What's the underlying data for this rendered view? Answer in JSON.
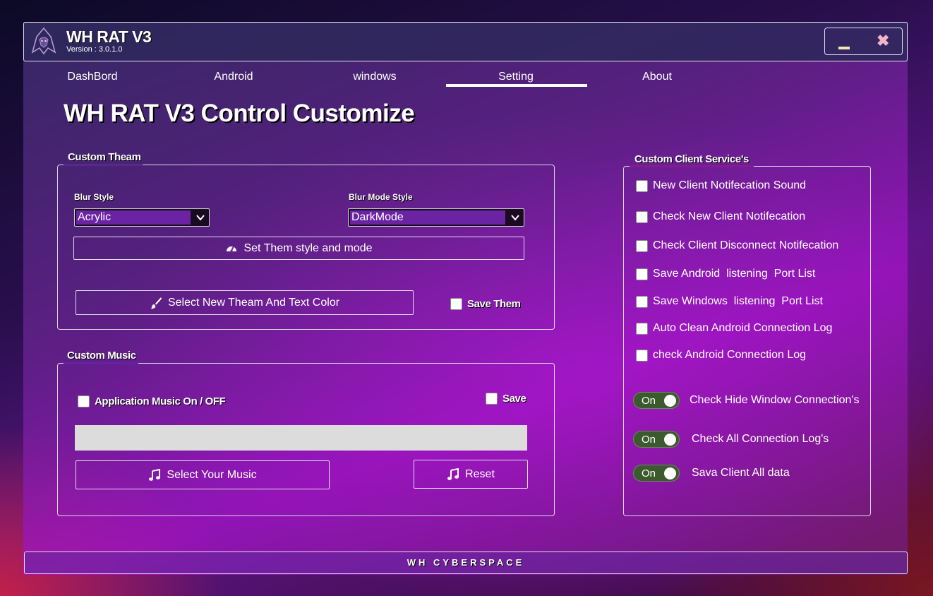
{
  "app": {
    "title": "WH RAT V3",
    "version": "Version : 3.0.1.0"
  },
  "window_buttons": {
    "minimize": "minimize-icon",
    "close": "✖"
  },
  "tabs": [
    {
      "label": "DashBord"
    },
    {
      "label": "Android"
    },
    {
      "label": "windows"
    },
    {
      "label": "Setting",
      "active": true
    },
    {
      "label": "About"
    }
  ],
  "page_title": "WH RAT V3 Control Customize",
  "custom_theme": {
    "legend": "Custom Theam",
    "blur_style_label": "Blur Style",
    "blur_style_value": "Acrylic",
    "blur_mode_label": "Blur Mode Style",
    "blur_mode_value": "DarkMode",
    "set_button": "Set Them style and mode",
    "select_color_button": "Select New Theam And Text Color",
    "save_checkbox": "Save Them"
  },
  "custom_music": {
    "legend": "Custom Music",
    "music_toggle": "Application Music On / OFF",
    "save_checkbox": "Save",
    "select_button": "Select Your Music",
    "reset_button": "Reset"
  },
  "client_services": {
    "legend": "Custom Client Service's",
    "checkboxes": [
      "New Client Notifecation Sound",
      "Check New Client Notifecation",
      "Check Client Disconnect Notifecation",
      "Save Android  listening  Port List",
      "Save Windows  listening  Port List",
      "Auto Clean Android Connection Log",
      "check Android Connection Log"
    ],
    "toggles": [
      {
        "state": "On",
        "label": "Check Hide Window Connection's"
      },
      {
        "state": "On",
        "label": "Check All Connection Log's"
      },
      {
        "state": "On",
        "label": "Sava Client All data"
      }
    ]
  },
  "footer": "WH CYBERSPACE",
  "colors": {
    "accent": "#6a23a2",
    "toggle": "#3b5a2e",
    "border": "#e6e0f0"
  }
}
